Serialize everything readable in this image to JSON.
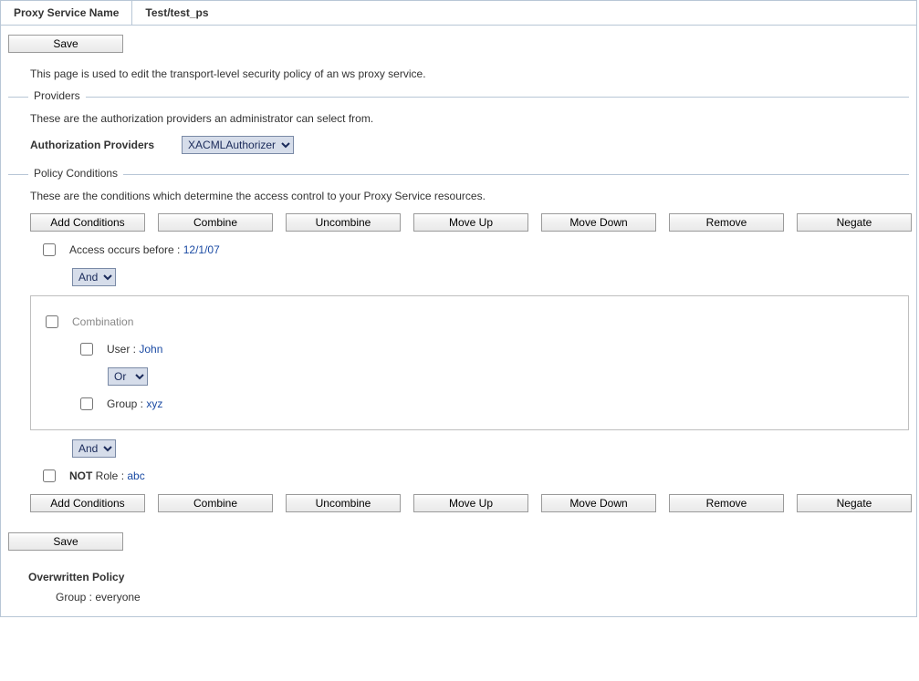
{
  "header": {
    "label": "Proxy Service Name",
    "value": "Test/test_ps"
  },
  "save_label": "Save",
  "page_desc": "This page is used to edit the transport-level security policy of an ws proxy service.",
  "providers": {
    "legend": "Providers",
    "note": "These are the authorization providers an administrator can select from.",
    "label": "Authorization Providers",
    "selected": "XACMLAuthorizer",
    "options": [
      "XACMLAuthorizer"
    ]
  },
  "conditions": {
    "legend": "Policy Conditions",
    "note": "These are the conditions which determine the access control to your Proxy Service resources.",
    "buttons": {
      "add": "Add Conditions",
      "combine": "Combine",
      "uncombine": "Uncombine",
      "moveup": "Move Up",
      "movedown": "Move Down",
      "remove": "Remove",
      "negate": "Negate"
    },
    "row_access": {
      "label": "Access occurs before : ",
      "value": "12/1/07"
    },
    "op_and": "And",
    "combo_label": "Combination",
    "row_user": {
      "label": "User : ",
      "value": "John"
    },
    "op_or": "Or",
    "row_group": {
      "label": "Group : ",
      "value": "xyz"
    },
    "row_not": {
      "not": "NOT",
      "label": " Role : ",
      "value": "abc"
    }
  },
  "overwritten": {
    "heading": "Overwritten Policy",
    "text": "Group : everyone"
  }
}
